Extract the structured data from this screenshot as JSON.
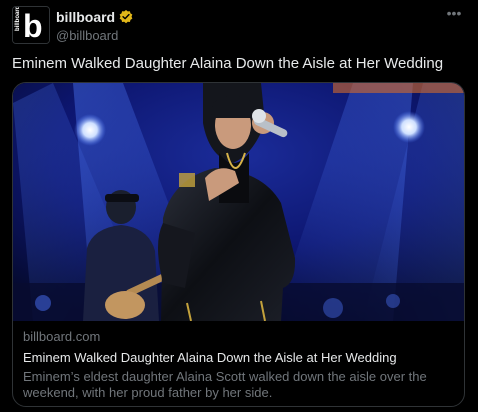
{
  "author": {
    "display_name": "billboard",
    "handle": "@billboard",
    "avatar_letter": "b",
    "avatar_side_text": "billboard",
    "verified_icon": "verified-badge-icon",
    "verified_color": "#e2b719"
  },
  "more_icon": "more-options-icon",
  "tweet": {
    "text": "Eminem Walked Daughter Alaina Down the Aisle at Her Wedding"
  },
  "card": {
    "image_description_icon": "concert-photo",
    "domain": "billboard.com",
    "title": "Eminem Walked Daughter Alaina Down the Aisle at Her Wedding",
    "description": "Eminem’s eldest daughter Alaina Scott walked down the aisle over the weekend, with her proud father by her side."
  },
  "colors": {
    "background": "#000000",
    "text_primary": "#e7e9ea",
    "text_secondary": "#71767b",
    "border": "#2f3336"
  }
}
